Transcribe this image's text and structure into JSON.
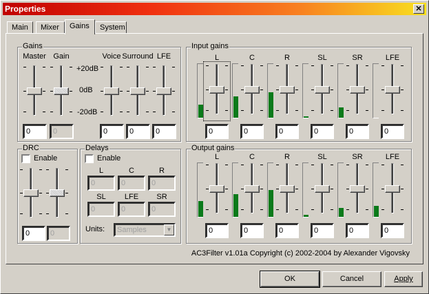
{
  "window": {
    "title": "Properties",
    "close_label": "✕"
  },
  "tabs": [
    {
      "label": "Main"
    },
    {
      "label": "Mixer"
    },
    {
      "label": "Gains",
      "active": true
    },
    {
      "label": "System"
    }
  ],
  "gains": {
    "title": "Gains",
    "scale": {
      "top": "+20dB",
      "mid": "0dB",
      "bottom": "-20dB"
    },
    "sliders": [
      {
        "label": "Master",
        "value": "0",
        "enabled": true,
        "level": 0.5
      },
      {
        "label": "Gain",
        "value": "0",
        "enabled": false,
        "level": 0.5
      },
      {
        "label": "Voice",
        "value": "0",
        "enabled": true,
        "level": 0.5
      },
      {
        "label": "Surround",
        "value": "0",
        "enabled": true,
        "level": 0.5
      },
      {
        "label": "LFE",
        "value": "0",
        "enabled": true,
        "level": 0.5
      }
    ]
  },
  "input_gains": {
    "title": "Input gains",
    "channels": [
      {
        "label": "L",
        "value": "0",
        "meter": 0.25
      },
      {
        "label": "C",
        "value": "0",
        "meter": 0.4
      },
      {
        "label": "R",
        "value": "0",
        "meter": 0.47
      },
      {
        "label": "SL",
        "value": "0",
        "meter": 0.02
      },
      {
        "label": "SR",
        "value": "0",
        "meter": 0.19
      },
      {
        "label": "LFE",
        "value": "0",
        "meter": 0
      }
    ]
  },
  "output_gains": {
    "title": "Output gains",
    "channels": [
      {
        "label": "L",
        "value": "0",
        "meter": 0.3
      },
      {
        "label": "C",
        "value": "0",
        "meter": 0.42
      },
      {
        "label": "R",
        "value": "0",
        "meter": 0.5
      },
      {
        "label": "SL",
        "value": "0",
        "meter": 0.04
      },
      {
        "label": "SR",
        "value": "0",
        "meter": 0.17
      },
      {
        "label": "LFE",
        "value": "0",
        "meter": 0.2
      }
    ]
  },
  "drc": {
    "title": "DRC",
    "enable_label": "Enable",
    "enabled": false,
    "values": [
      "0",
      "0"
    ]
  },
  "delays": {
    "title": "Delays",
    "enable_label": "Enable",
    "enabled": false,
    "channels": [
      {
        "label": "L",
        "value": "0"
      },
      {
        "label": "C",
        "value": "0"
      },
      {
        "label": "R",
        "value": "0"
      },
      {
        "label": "SL",
        "value": "0"
      },
      {
        "label": "LFE",
        "value": "0"
      },
      {
        "label": "SR",
        "value": "0"
      }
    ],
    "units_label": "Units:",
    "units_value": "Samples"
  },
  "copyright": "AC3Filter v1.01a Copyright (c) 2002-2004 by Alexander Vigovsky",
  "buttons": {
    "ok": "OK",
    "cancel": "Cancel",
    "apply": "Apply"
  }
}
